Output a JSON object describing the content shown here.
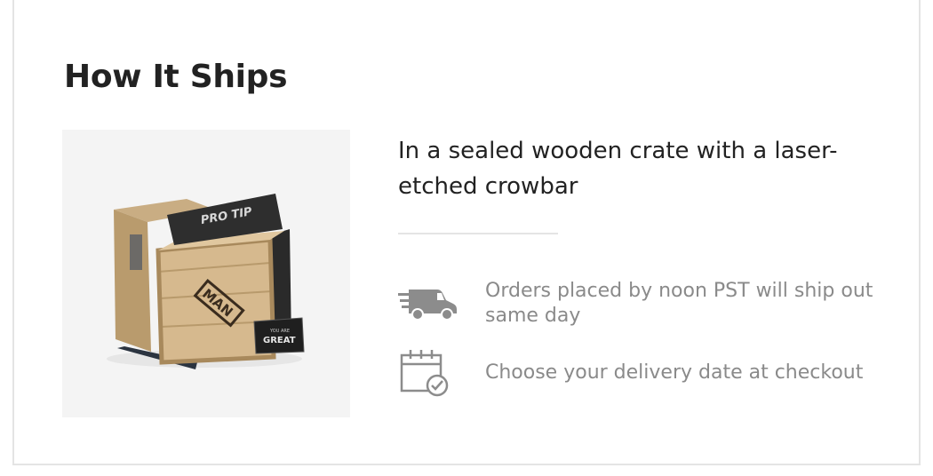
{
  "section": {
    "title": "How It Ships",
    "image_alt": "Wooden crate inside cardboard box with crowbar, Pro Tip card and You Are Great card",
    "crate_label": "MAN",
    "card_top_label": "PRO TIP",
    "card_small_text": "YOU ARE",
    "card_big_text": "GREAT"
  },
  "tagline": "In a sealed wooden crate with a laser-etched crowbar",
  "features": [
    {
      "icon": "delivery-truck-icon",
      "text": "Orders placed by noon PST will ship out same day"
    },
    {
      "icon": "calendar-check-icon",
      "text": "Choose your delivery date at checkout"
    }
  ],
  "colors": {
    "title": "#222222",
    "feature_text": "#8a8a8a",
    "icon": "#8c8c8c",
    "border": "#e4e4e4",
    "image_bg": "#f4f4f4"
  }
}
